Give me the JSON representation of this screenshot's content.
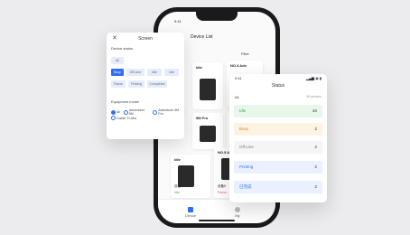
{
  "phone": {
    "time": "9:41",
    "title": "Device List",
    "filter": "Filter"
  },
  "screen_panel": {
    "close": "✕",
    "title": "Screen",
    "device_status_label": "Device status",
    "chips": [
      "All",
      "Busy",
      "Off-Line",
      "Idle",
      "Idle",
      "Pause",
      "Printing",
      "Completed"
    ],
    "equipment_label": "Equipment model",
    "radios": [
      "All",
      "Adventurer 5M",
      "Adventurer 5M Pro",
      "Guider 3 Ultra"
    ]
  },
  "cards": [
    {
      "name": "idle",
      "status": "",
      "color": "#2d6ff6"
    },
    {
      "name": "NO.3 Adv",
      "status": "Error",
      "color": "#e04848",
      "sub": "设备3"
    },
    {
      "name": "5M Pro",
      "status": "",
      "color": "#2d6ff6"
    },
    {
      "name": "NO.4 Adv",
      "status": "Off-Line",
      "color": "#888",
      "sub": "设备4"
    },
    {
      "name": "Idle",
      "status": "Idle",
      "color": "#39b54a",
      "sub": "设备4"
    },
    {
      "name": "NO.5 Adv",
      "status": "Pause",
      "color": "#e0589a",
      "sub": "设备5"
    }
  ],
  "tabs": [
    "Device",
    "My"
  ],
  "status_panel": {
    "time": "9:41",
    "indicators": "▂▄▆ ◉ ▮",
    "title": "Status",
    "all_label": "All",
    "count_label": "26 devices",
    "rows": [
      {
        "label": "Idle",
        "count": "40",
        "bg": "#e9f6ea",
        "color": "#3aa64a"
      },
      {
        "label": "Busy",
        "count": "2",
        "bg": "#fdf3e2",
        "color": "#d18a1a"
      },
      {
        "label": "Off-Line",
        "count": "2",
        "bg": "#f5f5f5",
        "color": "#777"
      },
      {
        "label": "Printing",
        "count": "2",
        "bg": "#eaf0fd",
        "color": "#2d6ff6"
      },
      {
        "label": "已完成",
        "count": "2",
        "bg": "#eaf0fd",
        "color": "#2d6ff6"
      }
    ]
  }
}
